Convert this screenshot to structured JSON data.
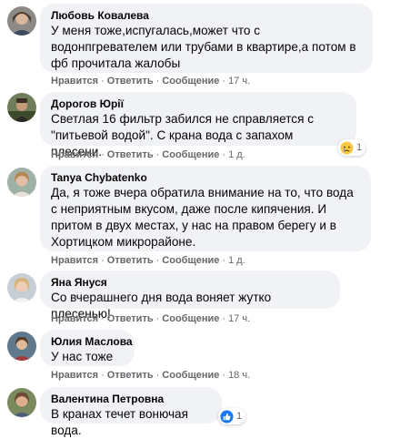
{
  "actions": {
    "like": "Нравится",
    "reply": "Ответить",
    "message": "Сообщение",
    "separator": "·"
  },
  "comments": [
    {
      "author": "Любовь Ковалева",
      "text": "У меня тоже,испугалась,может что с водонпгревателем или трубами в квартире,а потом в фб прочитала жалобы",
      "time": "17 ч."
    },
    {
      "author": "Дорогов Юрiї",
      "text": "Светлая 16 фильтр забился не справляется с \"питьевой водой\". С крана вода с запахом плесени.",
      "time": "1 д.",
      "reaction": {
        "icon": "sad-face-icon",
        "count": "1"
      }
    },
    {
      "author": "Tanya Chybatenko",
      "text": "Да, я тоже вчера обратила внимание на то, что вода с неприятным вкусом, даже после кипячения. И притом в двух местах, у нас на правом берегу и в Хортицком микрорайоне.",
      "time": "1 д."
    },
    {
      "author": "Яна Януся",
      "text": "Со вчерашнего дня вода воняет жутко плесенью!",
      "time": "17 ч."
    },
    {
      "author": "Юлия Маслова",
      "text": "У нас тоже",
      "time": "18 ч."
    },
    {
      "author": "Валентина Петровна",
      "text": "В кранах течет вонючая вода.",
      "time": "",
      "reaction": {
        "icon": "like-icon",
        "count": "1"
      }
    }
  ]
}
